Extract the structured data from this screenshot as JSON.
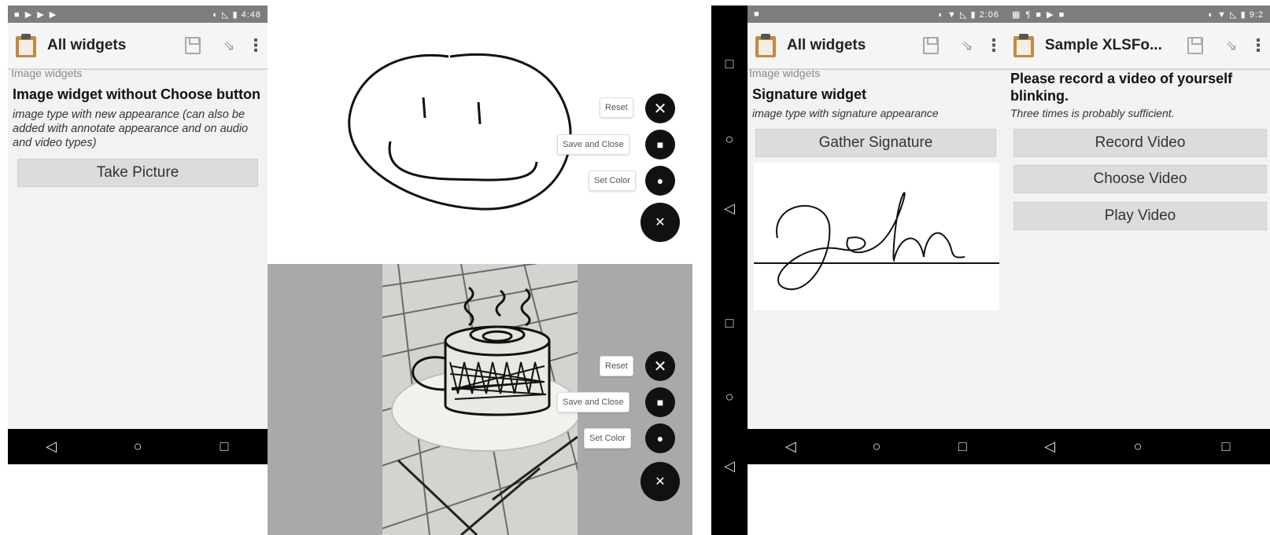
{
  "screen1": {
    "status_time": "4:48",
    "title": "All widgets",
    "group_label": "Image widgets",
    "question": "Image widget without Choose button",
    "hint": "image type with new appearance (can also be added with annotate appearance and on audio and video types)",
    "button": "Take Picture"
  },
  "annotate_top": {
    "reset_label": "Reset",
    "save_label": "Save and Close",
    "color_label": "Set Color"
  },
  "annotate_bottom": {
    "reset_label": "Reset",
    "save_label": "Save and Close",
    "color_label": "Set Color"
  },
  "screen3": {
    "status_time": "2:06",
    "title": "All widgets",
    "group_label": "Image widgets",
    "question": "Signature widget",
    "hint": "image type with signature appearance",
    "button": "Gather Signature"
  },
  "screen4": {
    "status_time": "9:2",
    "title": "Sample XLSFo...",
    "question": "Please record a video of yourself blinking.",
    "hint": "Three times is probably sufficient.",
    "buttons": [
      "Record Video",
      "Choose Video",
      "Play Video"
    ]
  },
  "icons": {
    "back": "◁",
    "home": "○",
    "recents": "□",
    "close": "✕",
    "menu": "⋮"
  },
  "colors": {
    "status_bar": "#7d7d7d",
    "nav_bar": "#000000",
    "button_bg": "#dcdcdc",
    "fab": "#111111"
  }
}
